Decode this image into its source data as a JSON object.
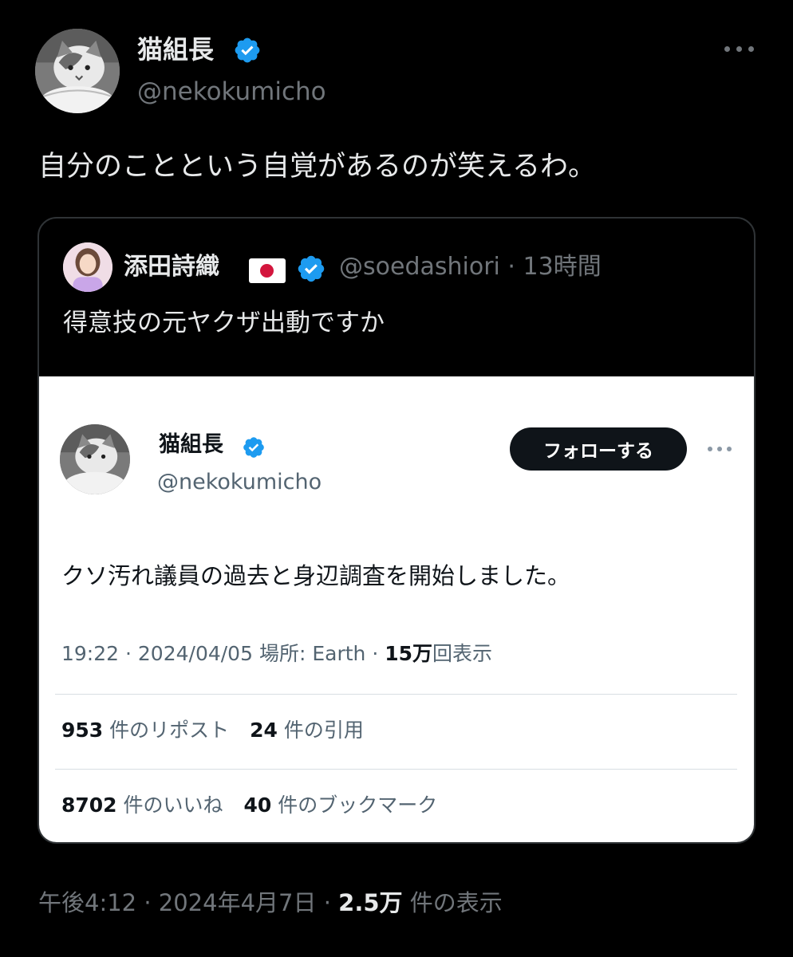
{
  "author": {
    "name": "猫組長",
    "handle": "@nekokumicho"
  },
  "tweet": {
    "text": "自分のことという自覚があるのが笑えるわ。",
    "time": "午後4:12",
    "date": "2024年4月7日",
    "views_count": "2.5万",
    "views_label": "件の表示",
    "separator": "·"
  },
  "quote": {
    "name": "添田詩織",
    "handle": "@soedashiori",
    "separator": "·",
    "age": "13時間",
    "text": "得意技の元ヤクザ出動ですか"
  },
  "embedded": {
    "name": "猫組長",
    "handle": "@nekokumicho",
    "follow_label": "フォローする",
    "text": "クソ汚れ議員の過去と身辺調査を開始しました。",
    "time": "19:22",
    "date": "2024/04/05",
    "location_label": "場所:",
    "location": "Earth",
    "views_count": "15万",
    "views_label": "回表示",
    "separator": "·",
    "stats": {
      "reposts_count": "953",
      "reposts_label": "件のリポスト",
      "quotes_count": "24",
      "quotes_label": "件の引用",
      "likes_count": "8702",
      "likes_label": "件のいいね",
      "bookmarks_count": "40",
      "bookmarks_label": "件のブックマーク"
    }
  },
  "icons": {
    "verified": "verified-badge-icon",
    "more": "more-horizontal-icon",
    "flag": "japan-flag-icon"
  },
  "colors": {
    "background": "#000000",
    "text_primary": "#e7e9ea",
    "text_secondary": "#71767b",
    "verified_blue": "#1d9bf0",
    "card_background": "#ffffff",
    "follow_button": "#0f1419"
  }
}
